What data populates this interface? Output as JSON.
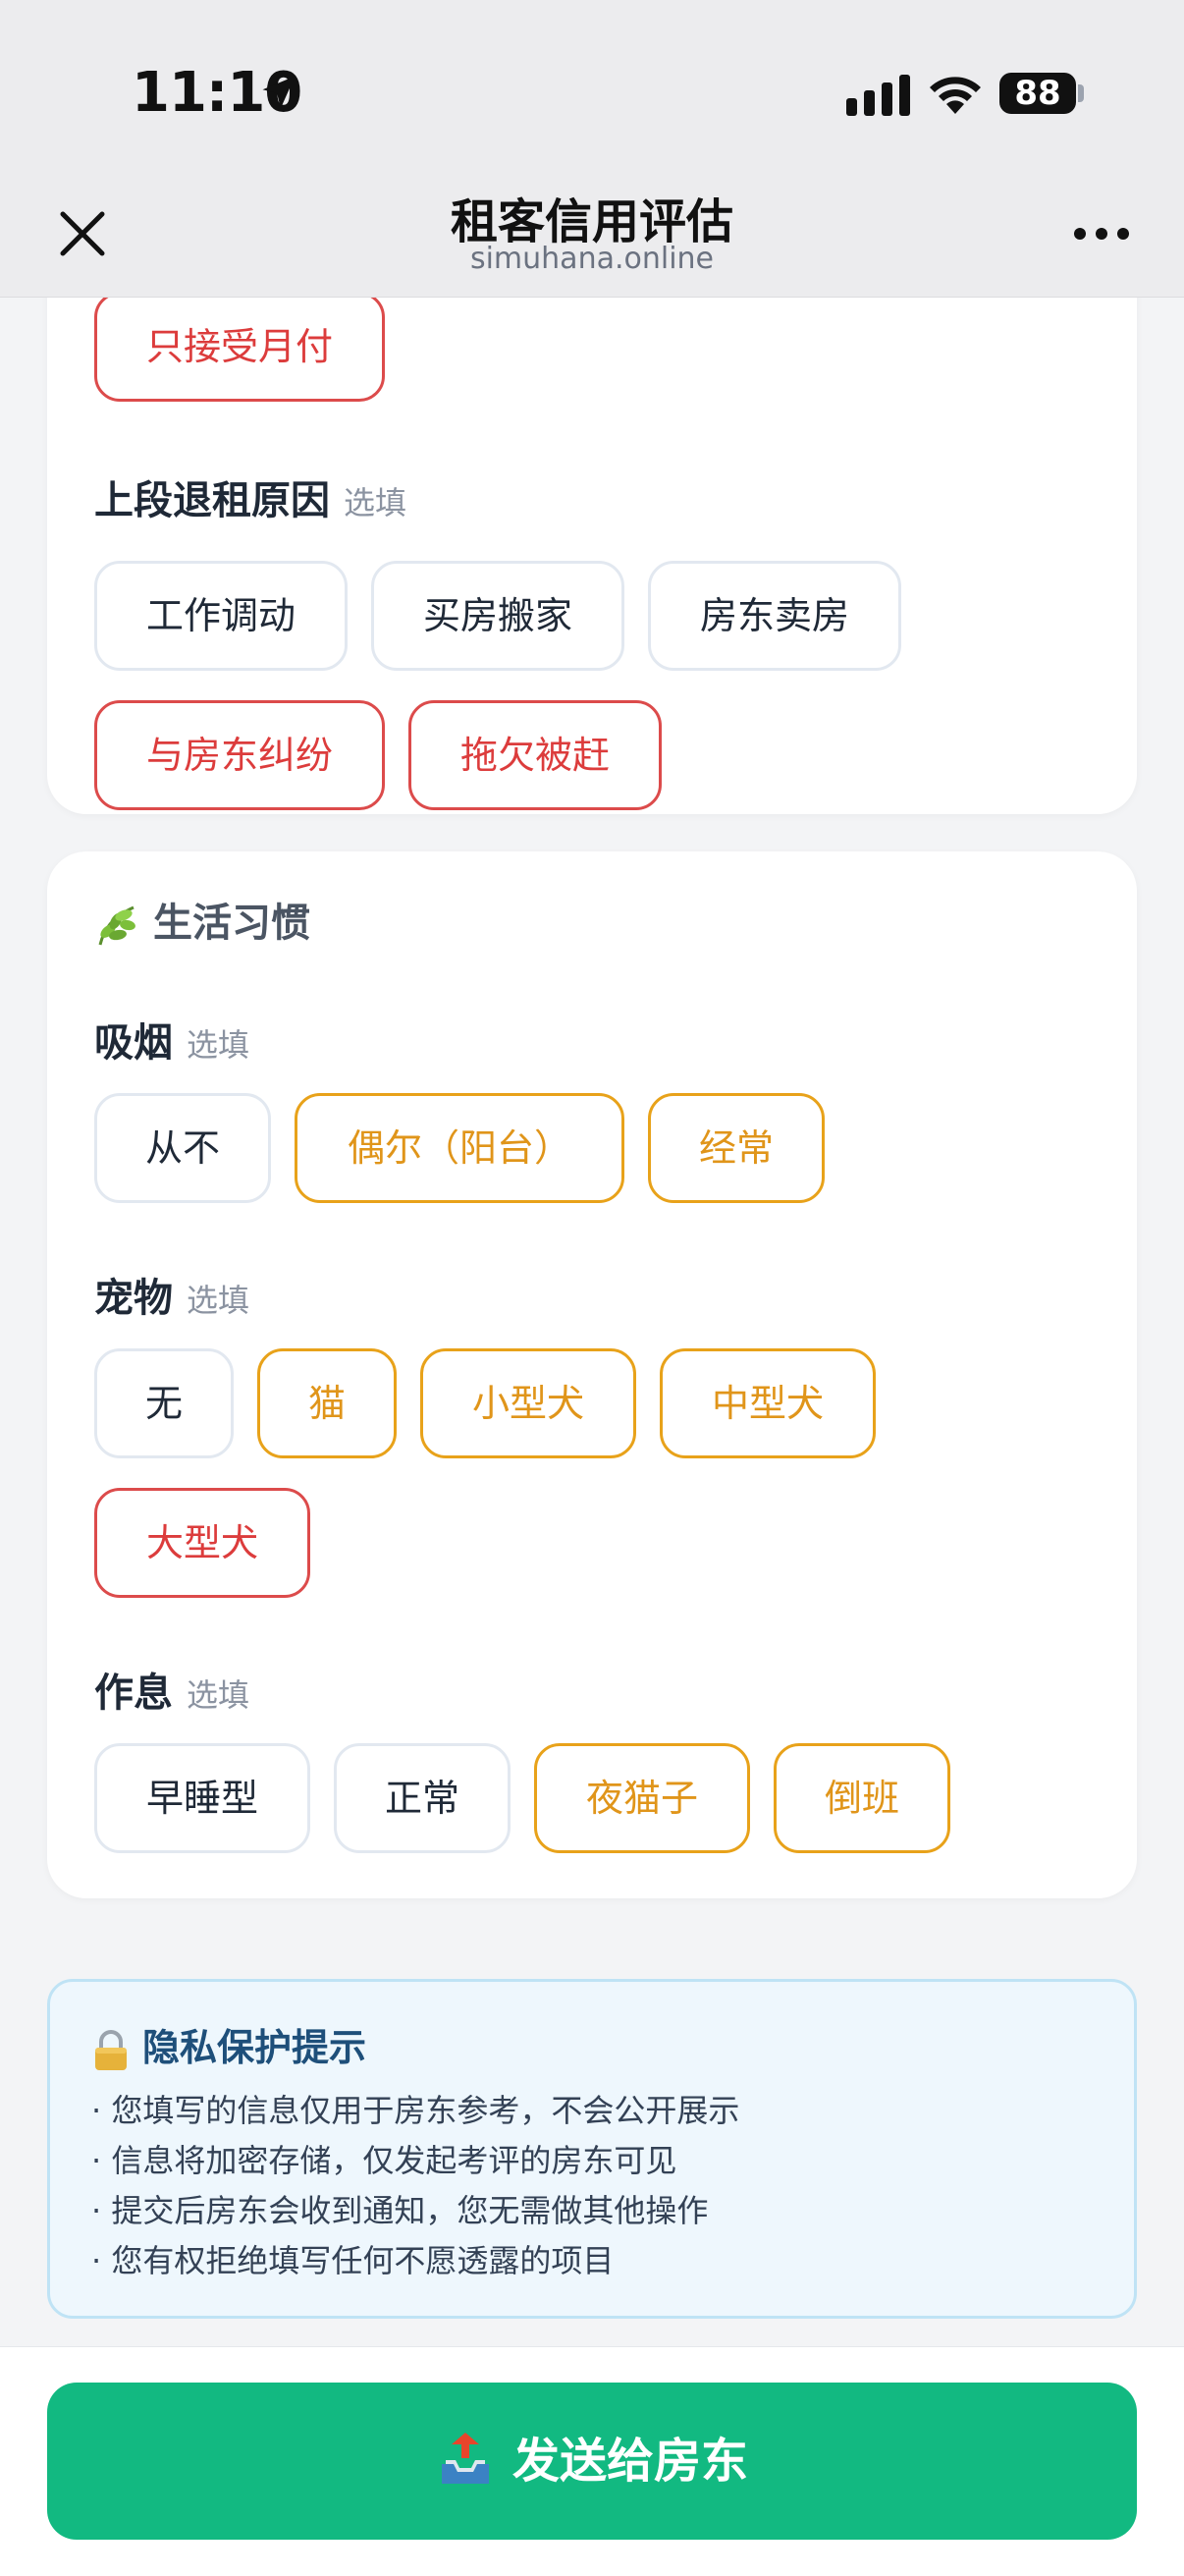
{
  "status_bar": {
    "time": "11:10",
    "battery": "88"
  },
  "nav": {
    "title": "租客信用评估",
    "subtitle": "simuhana.online"
  },
  "payment": {
    "visible_option": "只接受月付"
  },
  "last_move_reason": {
    "label": "上段退租原因",
    "optional": "选填",
    "options": [
      "工作调动",
      "买房搬家",
      "房东卖房",
      "与房东纠纷",
      "拖欠被赶"
    ]
  },
  "lifestyle": {
    "title": "生活习惯",
    "smoking": {
      "label": "吸烟",
      "optional": "选填",
      "options": [
        "从不",
        "偶尔（阳台）",
        "经常"
      ]
    },
    "pets": {
      "label": "宠物",
      "optional": "选填",
      "options": [
        "无",
        "猫",
        "小型犬",
        "中型犬",
        "大型犬"
      ]
    },
    "schedule": {
      "label": "作息",
      "optional": "选填",
      "options": [
        "早睡型",
        "正常",
        "夜猫子",
        "倒班"
      ]
    }
  },
  "privacy": {
    "title": "隐私保护提示",
    "items": [
      "您填写的信息仅用于房东参考，不会公开展示",
      "信息将加密存储，仅发起考评的房东可见",
      "提交后房东会收到通知，您无需做其他操作",
      "您有权拒绝填写任何不愿透露的项目"
    ]
  },
  "submit": {
    "label": "发送给房东"
  },
  "colors": {
    "accent_green": "#12b981",
    "warn_red": "#dc3c3c",
    "warn_orange": "#e0951a",
    "info_blue": "#1e4f7a"
  }
}
